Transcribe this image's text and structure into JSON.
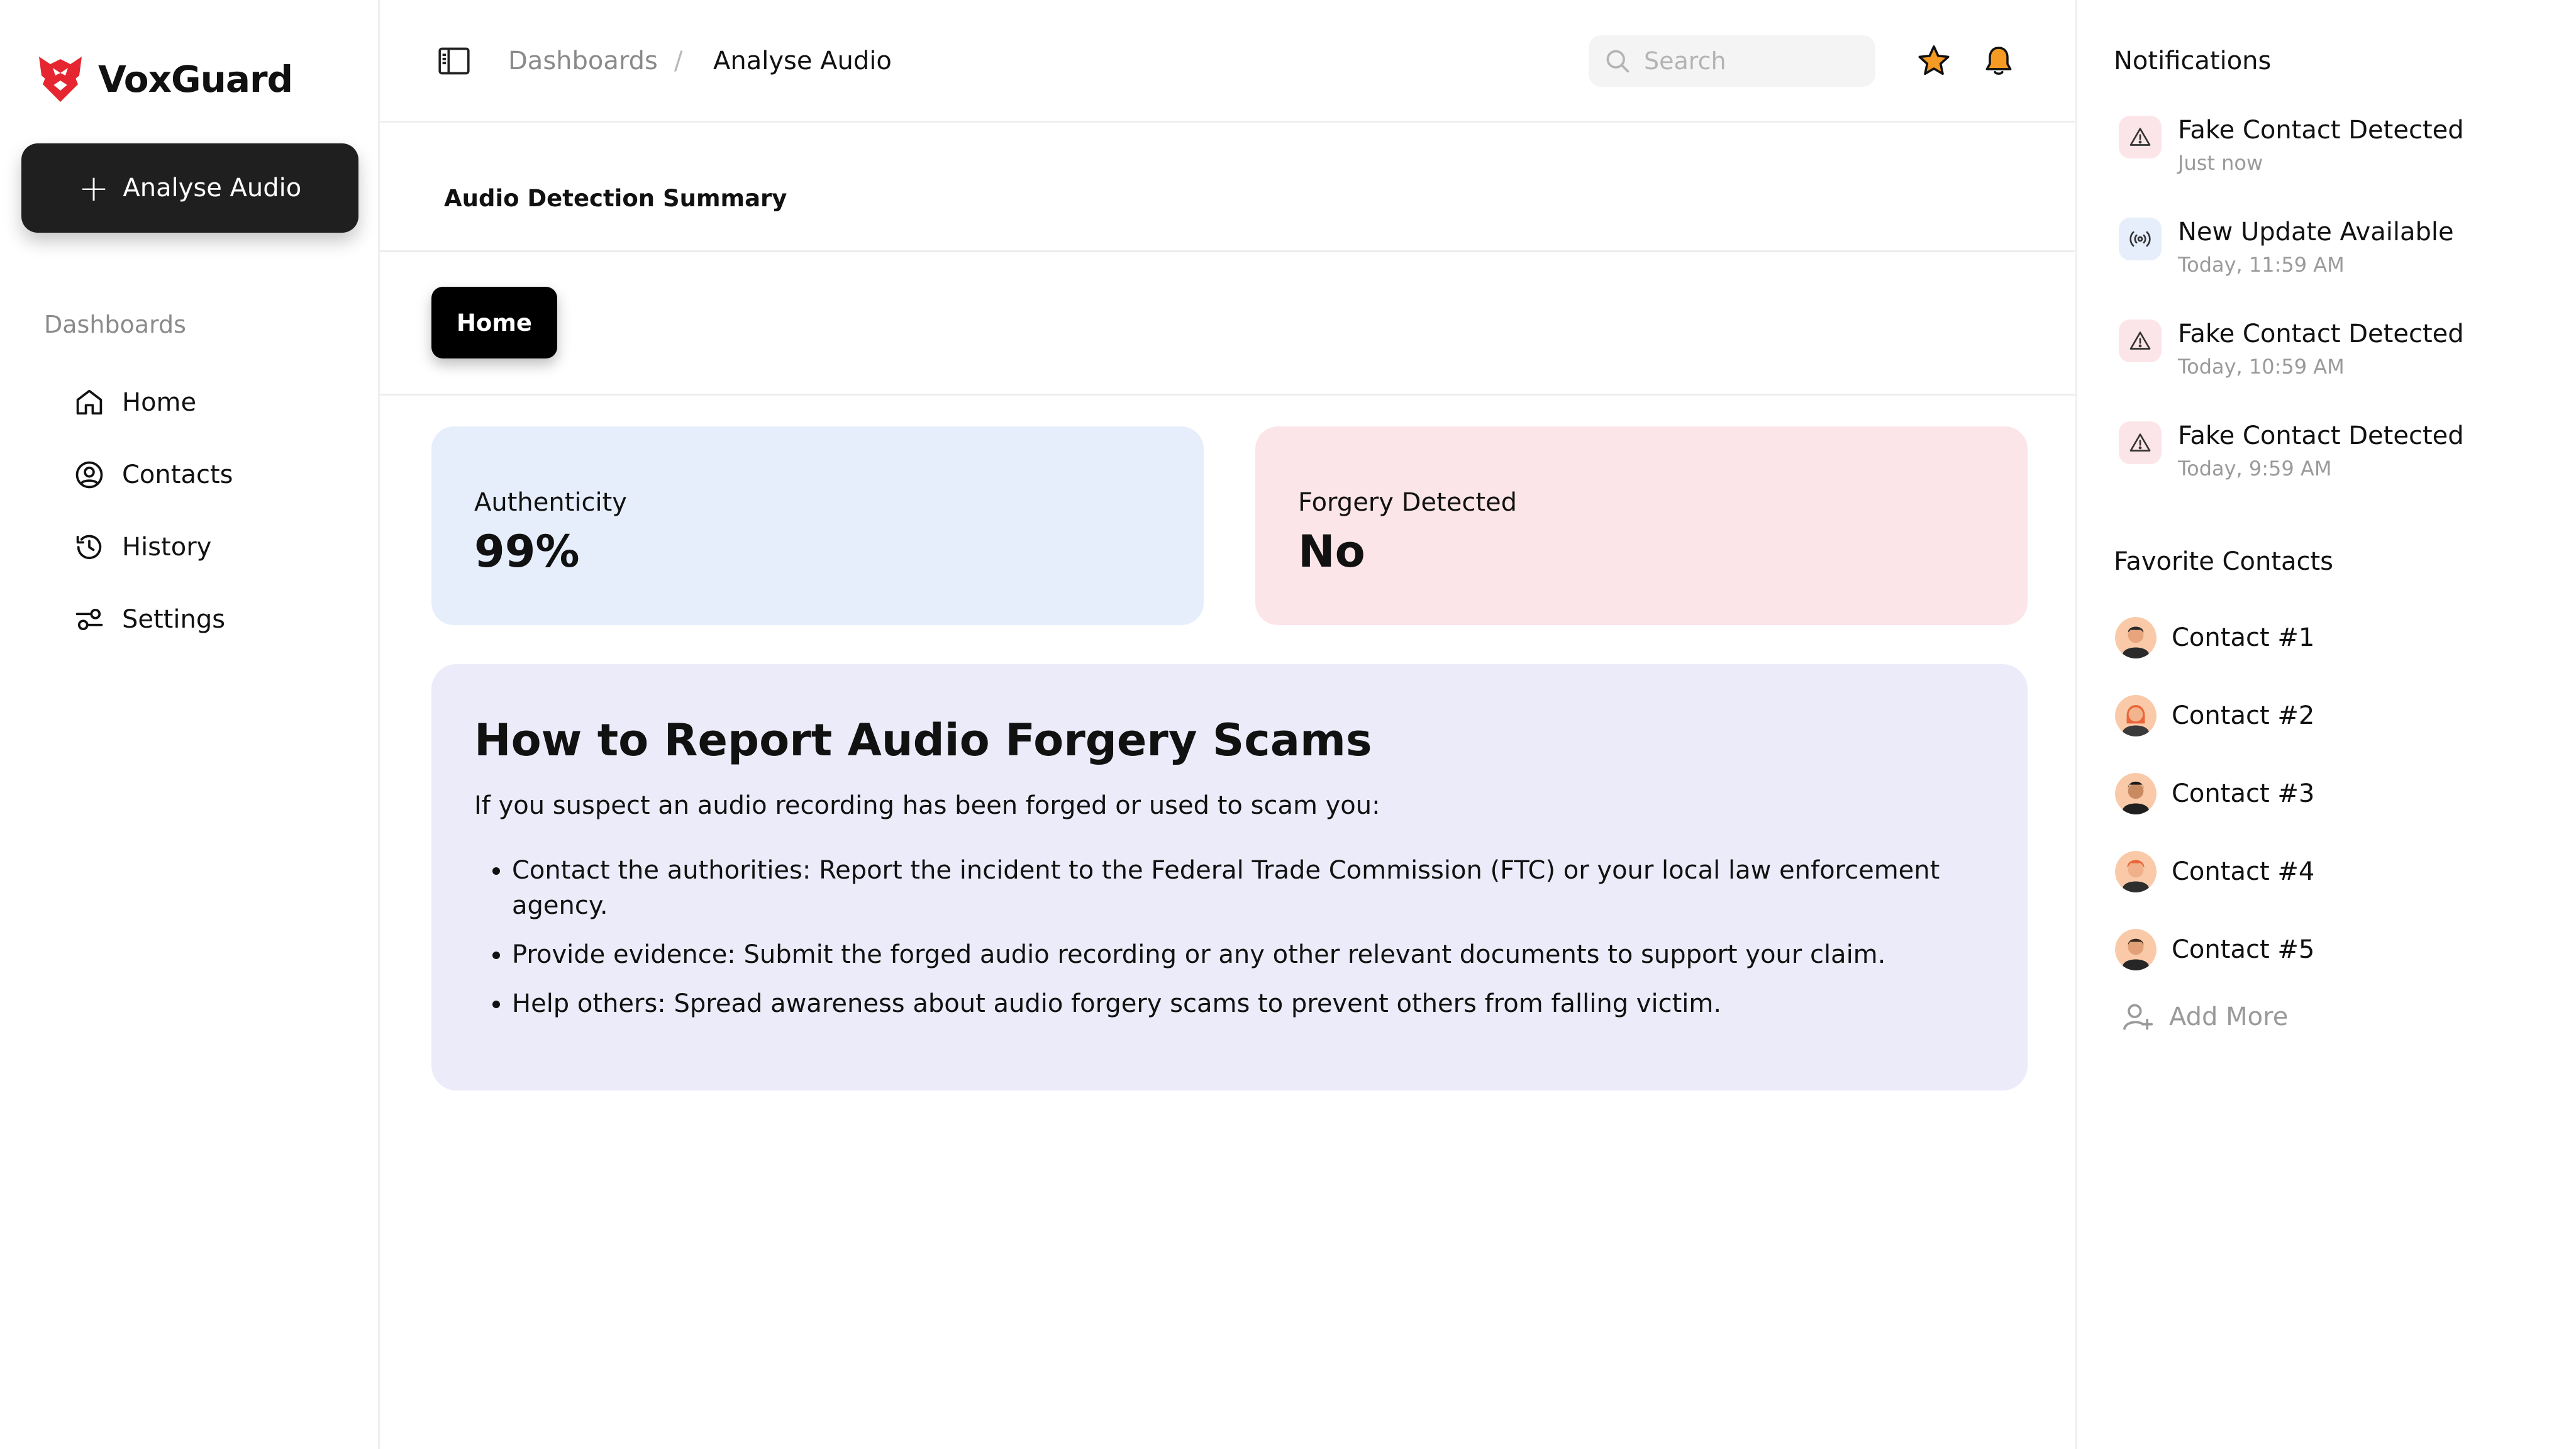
{
  "brand": {
    "name": "VoxGuard",
    "color": "#e5252f"
  },
  "sidebar": {
    "primary_action": "Analyse Audio",
    "section_label": "Dashboards",
    "items": [
      {
        "label": "Home",
        "icon": "home-icon"
      },
      {
        "label": "Contacts",
        "icon": "user-circle-icon"
      },
      {
        "label": "History",
        "icon": "history-icon"
      },
      {
        "label": "Settings",
        "icon": "settings-sliders-icon"
      }
    ]
  },
  "header": {
    "breadcrumb": [
      "Dashboards",
      "Analyse Audio"
    ],
    "breadcrumb_separator": "/",
    "search_placeholder": "Search",
    "icons": [
      "sidebar-toggle-icon",
      "star-icon",
      "bell-icon"
    ],
    "accent_color": "#f59a23"
  },
  "main": {
    "section_title": "Audio Detection Summary",
    "active_tab": "Home",
    "stats": [
      {
        "label": "Authenticity",
        "value": "99%",
        "color": "#e6eefc"
      },
      {
        "label": "Forgery Detected",
        "value": "No",
        "color": "#fce5e8"
      }
    ],
    "info": {
      "title": "How to Report Audio Forgery Scams",
      "intro": "If you suspect an audio recording has been forged or used to scam you:",
      "items": [
        "Contact the authorities: Report the incident to the Federal Trade Commission (FTC) or your local law enforcement agency.",
        "Provide evidence: Submit the forged audio recording or any other relevant documents to support your claim.",
        "Help others: Spread awareness about audio forgery scams to prevent others from falling victim."
      ]
    }
  },
  "notifications": {
    "title": "Notifications",
    "items": [
      {
        "title": "Fake Contact Detected",
        "time": "Just now",
        "icon": "warning-icon"
      },
      {
        "title": "New Update Available",
        "time": "Today, 11:59 AM",
        "icon": "broadcast-icon"
      },
      {
        "title": "Fake Contact Detected",
        "time": "Today, 10:59 AM",
        "icon": "warning-icon"
      },
      {
        "title": "Fake Contact Detected",
        "time": "Today, 9:59 AM",
        "icon": "warning-icon"
      }
    ]
  },
  "favorites": {
    "title": "Favorite Contacts",
    "contacts": [
      "Contact #1",
      "Contact #2",
      "Contact #3",
      "Contact #4",
      "Contact #5"
    ],
    "add_more": "Add More"
  }
}
